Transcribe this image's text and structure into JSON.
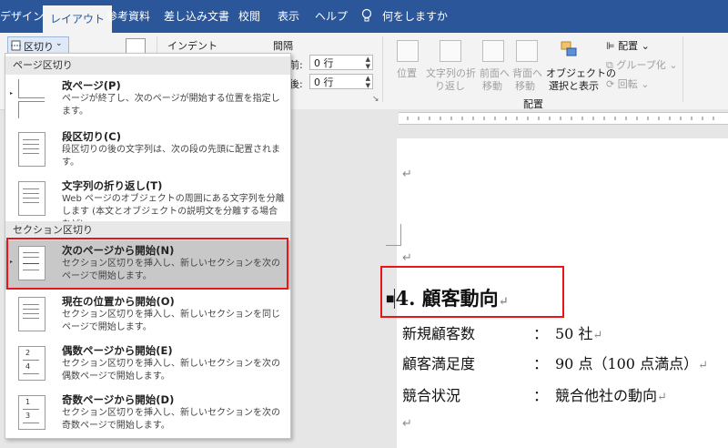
{
  "tabs": [
    "デザイン",
    "レイアウト",
    "参考資料",
    "差し込み文書",
    "校閲",
    "表示",
    "ヘルプ"
  ],
  "tell_me": "何をしますか",
  "ribbon": {
    "breaks_label": "区切り",
    "indent_label": "インデント",
    "spacing_label": "間隔",
    "before_label": "前:",
    "before_value": "0 行",
    "after_label": "後:",
    "after_value": "0 行",
    "position_label_1": "位置",
    "wrap_label_1": "文字列の折",
    "wrap_label_2": "り返し",
    "front_label_1": "前面へ",
    "front_label_2": "移動",
    "back_label_1": "背面へ",
    "back_label_2": "移動",
    "selection_label_1": "オブジェクトの",
    "selection_label_2": "選択と表示",
    "align_label": "配置",
    "group_label": "グループ化",
    "rotate_label": "回転",
    "arrange_group": "配置"
  },
  "dropdown": {
    "page_breaks_header": "ページ区切り",
    "section_breaks_header": "セクション区切り",
    "items": [
      {
        "title": "改ページ(P)",
        "desc": "ページが終了し、次のページが開始する位置を指定します。"
      },
      {
        "title": "段区切り(C)",
        "desc": "段区切りの後の文字列は、次の段の先頭に配置されます。"
      },
      {
        "title": "文字列の折り返し(T)",
        "desc": "Web ページのオブジェクトの周囲にある文字列を分離します (本文とオブジェクトの説明文を分離する場合など)。"
      },
      {
        "title": "次のページから開始(N)",
        "desc": "セクション区切りを挿入し、新しいセクションを次のページで開始します。"
      },
      {
        "title": "現在の位置から開始(O)",
        "desc": "セクション区切りを挿入し、新しいセクションを同じページで開始します。"
      },
      {
        "title": "偶数ページから開始(E)",
        "desc": "セクション区切りを挿入し、新しいセクションを次の偶数ページで開始します。"
      },
      {
        "title": "奇数ページから開始(D)",
        "desc": "セクション区切りを挿入し、新しいセクションを次の奇数ページで開始します。"
      }
    ]
  },
  "document": {
    "heading": "4.  顧客動向",
    "rows": [
      {
        "label": "新規顧客数",
        "sep": "：",
        "value": "50 社"
      },
      {
        "label": "顧客満足度",
        "sep": "：",
        "value": "90 点（100 点満点）"
      },
      {
        "label": "競合状況",
        "sep": "：",
        "value": "競合他社の動向"
      }
    ],
    "para_mark": "↵"
  },
  "colors": {
    "accent": "#2b579a",
    "highlight": "#e8161c"
  }
}
